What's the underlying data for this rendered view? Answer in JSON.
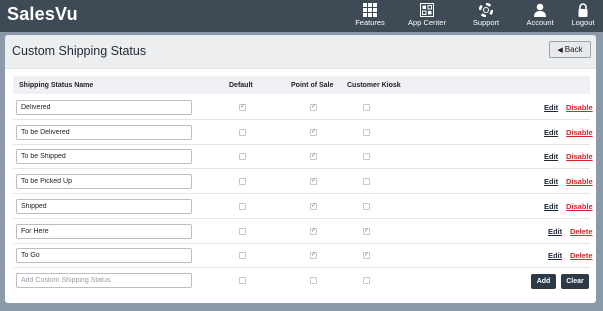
{
  "app": {
    "logo": "SalesVu"
  },
  "nav": [
    {
      "label": "Features",
      "icon": "grid-icon"
    },
    {
      "label": "App Center",
      "icon": "app-center-icon"
    },
    {
      "label": "Support",
      "icon": "lifebuoy-icon"
    },
    {
      "label": "Account",
      "icon": "person-icon"
    },
    {
      "label": "Logout",
      "icon": "lock-icon"
    }
  ],
  "page": {
    "title": "Custom Shipping Status",
    "back_label": "Back"
  },
  "table": {
    "headers": [
      "Shipping Status Name",
      "Default",
      "Point of Sale",
      "Customer Kiosk"
    ],
    "rows": [
      {
        "name": "Delivered",
        "default": true,
        "pos": true,
        "kiosk": false,
        "edit": "Edit",
        "action": "Disable"
      },
      {
        "name": "To be Delivered",
        "default": false,
        "pos": true,
        "kiosk": false,
        "edit": "Edit",
        "action": "Disable"
      },
      {
        "name": "To be Shipped",
        "default": false,
        "pos": true,
        "kiosk": false,
        "edit": "Edit",
        "action": "Disable"
      },
      {
        "name": "To be Picked Up",
        "default": false,
        "pos": true,
        "kiosk": false,
        "edit": "Edit",
        "action": "Disable"
      },
      {
        "name": "Shipped",
        "default": false,
        "pos": true,
        "kiosk": false,
        "edit": "Edit",
        "action": "Disable"
      },
      {
        "name": "For Here",
        "default": false,
        "pos": true,
        "kiosk": true,
        "edit": "Edit",
        "action": "Delete"
      },
      {
        "name": "To Go",
        "default": false,
        "pos": true,
        "kiosk": true,
        "edit": "Edit",
        "action": "Delete"
      }
    ],
    "new_row": {
      "placeholder": "Add Custom Shipping Status",
      "add_label": "Add",
      "clear_label": "Clear"
    }
  },
  "colors": {
    "topbar": "#3e4a55",
    "background": "#8a9aa8",
    "danger": "#d6272c",
    "button_dark": "#2d3a45"
  }
}
